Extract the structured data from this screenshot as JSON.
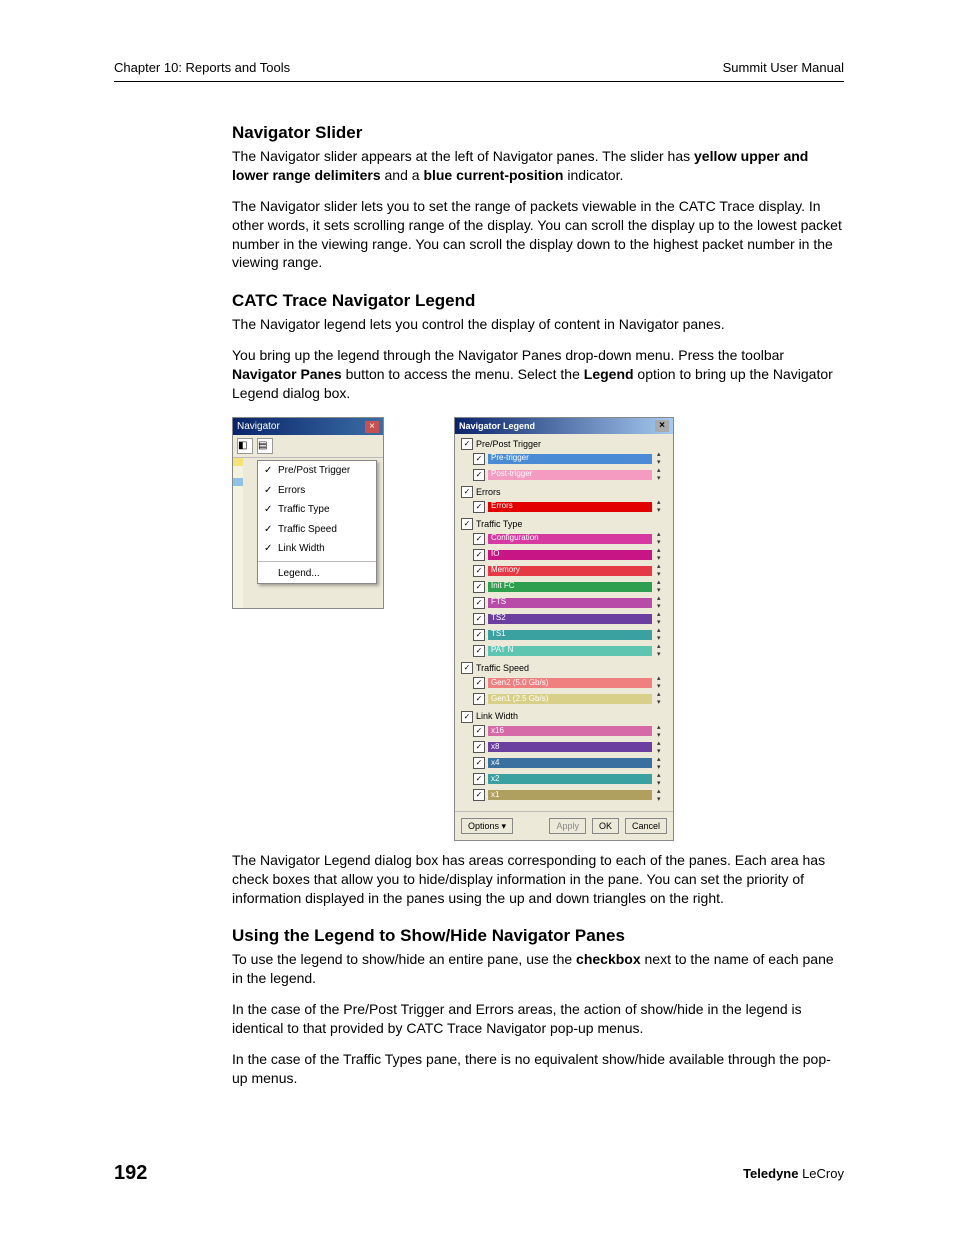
{
  "header": {
    "left": "Chapter 10: Reports and Tools",
    "right": "Summit User Manual"
  },
  "sec1": {
    "title": "Navigator Slider",
    "p1a": "The Navigator slider appears at the left of Navigator panes. The slider has ",
    "p1b": "yellow upper and lower range delimiters",
    "p1c": " and a ",
    "p1d": "blue current-position",
    "p1e": " indicator.",
    "p2": "The Navigator slider lets you to set the range of packets viewable in the CATC Trace display. In other words, it sets scrolling range of the display. You can scroll the display up to the lowest packet number in the viewing range. You can scroll the display down to the highest packet number in the viewing range."
  },
  "sec2": {
    "title": "CATC Trace Navigator Legend",
    "p1": "The Navigator legend lets you control the display of content in Navigator panes.",
    "p2a": "You bring up the legend through the Navigator Panes drop-down menu. Press the toolbar ",
    "p2b": "Navigator Panes",
    "p2c": " button to access the menu. Select the ",
    "p2d": "Legend",
    "p2e": " option to bring up the Navigator Legend dialog box.",
    "p3": "The Navigator Legend dialog box has areas corresponding to each of the panes. Each area has check boxes that allow you to hide/display information in the pane. You can set the priority of information displayed in the panes using the up and down triangles on the right."
  },
  "sec3": {
    "title": "Using the Legend to Show/Hide Navigator Panes",
    "p1a": "To use the legend to show/hide an entire pane, use the ",
    "p1b": "checkbox",
    "p1c": " next to the name of each pane in the legend.",
    "p2": "In the case of the Pre/Post Trigger and Errors areas, the action of show/hide in the legend is identical to that provided by CATC Trace Navigator pop-up menus.",
    "p3": "In the case of the Traffic Types pane, there is no equivalent show/hide available through the pop-up menus."
  },
  "navmenu": {
    "title": "Navigator",
    "items": [
      "Pre/Post Trigger",
      "Errors",
      "Traffic Type",
      "Traffic Speed",
      "Link Width"
    ],
    "legend": "Legend..."
  },
  "legend_dlg": {
    "title": "Navigator Legend",
    "groups": [
      {
        "name": "Pre/Post Trigger",
        "rows": [
          {
            "label": "Pre-trigger",
            "color": "#4a8bd6"
          },
          {
            "label": "Post-trigger",
            "color": "#f59ac0"
          }
        ]
      },
      {
        "name": "Errors",
        "rows": [
          {
            "label": "Errors",
            "color": "#e20000"
          }
        ]
      },
      {
        "name": "Traffic Type",
        "rows": [
          {
            "label": "Configuration",
            "color": "#d63aa0"
          },
          {
            "label": "IO",
            "color": "#c71585"
          },
          {
            "label": "Memory",
            "color": "#e63946"
          },
          {
            "label": "Init FC",
            "color": "#2e9e4f"
          },
          {
            "label": "FTS",
            "color": "#b84aa8"
          },
          {
            "label": "TS2",
            "color": "#6b3fa0"
          },
          {
            "label": "TS1",
            "color": "#3aa0a0"
          },
          {
            "label": "PAT N",
            "color": "#5ec6b0"
          }
        ]
      },
      {
        "name": "Traffic Speed",
        "rows": [
          {
            "label": "Gen2 (5.0 Gb/s)",
            "color": "#f08080"
          },
          {
            "label": "Gen1 (2.5 Gb/s)",
            "color": "#d8d088"
          }
        ]
      },
      {
        "name": "Link Width",
        "rows": [
          {
            "label": "x16",
            "color": "#d66aa8"
          },
          {
            "label": "x8",
            "color": "#6b3fa0"
          },
          {
            "label": "x4",
            "color": "#3a70a0"
          },
          {
            "label": "x2",
            "color": "#3aa0a0"
          },
          {
            "label": "x1",
            "color": "#b0a060"
          }
        ]
      }
    ],
    "btn_options": "Options ▾",
    "btn_apply": "Apply",
    "btn_ok": "OK",
    "btn_cancel": "Cancel"
  },
  "footer": {
    "page": "192",
    "brand_a": "Teledyne",
    "brand_b": " LeCroy"
  }
}
